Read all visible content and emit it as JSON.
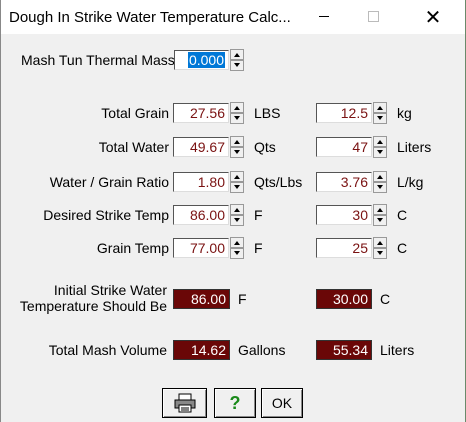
{
  "window": {
    "title": "Dough In Strike Water Temperature Calc...",
    "close_glyph": "✕"
  },
  "thermal": {
    "label": "Mash Tun Thermal Mass",
    "value": "0.000"
  },
  "rows": [
    {
      "label": "Total Grain",
      "us_value": "27.56",
      "us_unit": "LBS",
      "metric_value": "12.5",
      "metric_unit": "kg"
    },
    {
      "label": "Total Water",
      "us_value": "49.67",
      "us_unit": "Qts",
      "metric_value": "47",
      "metric_unit": "Liters"
    },
    {
      "label": "Water / Grain Ratio",
      "us_value": "1.80",
      "us_unit": "Qts/Lbs",
      "metric_value": "3.76",
      "metric_unit": "L/kg"
    },
    {
      "label": "Desired Strike Temp",
      "us_value": "86.00",
      "us_unit": "F",
      "metric_value": "30",
      "metric_unit": "C"
    },
    {
      "label": "Grain Temp",
      "us_value": "77.00",
      "us_unit": "F",
      "metric_value": "25",
      "metric_unit": "C"
    }
  ],
  "strike": {
    "label_line1": "Initial Strike Water",
    "label_line2": "Temperature Should Be",
    "us_value": "86.00",
    "us_unit": "F",
    "metric_value": "30.00",
    "metric_unit": "C"
  },
  "volume": {
    "label": "Total Mash Volume",
    "us_value": "14.62",
    "us_unit": "Gallons",
    "metric_value": "55.34",
    "metric_unit": "Liters"
  },
  "buttons": {
    "help_glyph": "?",
    "ok_label": "OK"
  },
  "icons": {
    "print": "printer-icon",
    "help": "help-icon"
  }
}
